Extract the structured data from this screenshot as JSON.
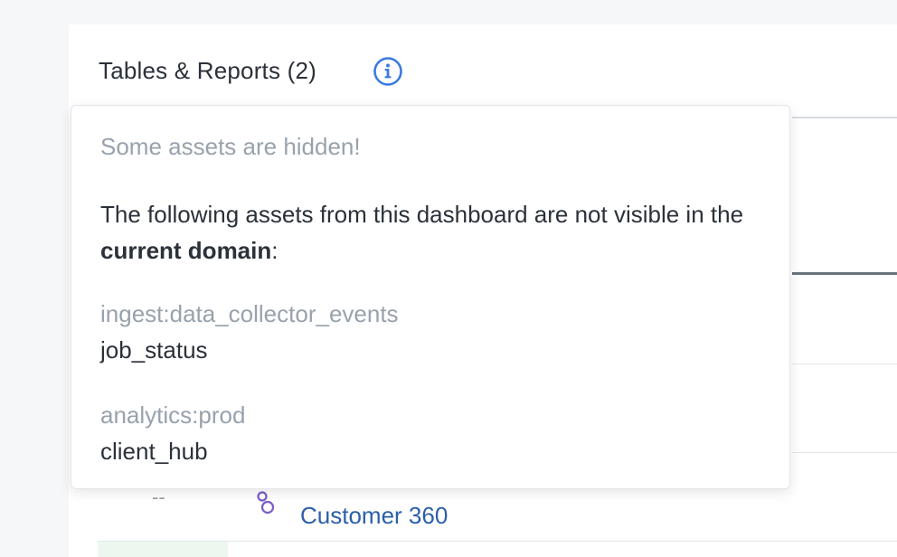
{
  "panel": {
    "title": "Tables & Reports (2)",
    "info_icon": "info-circle-icon"
  },
  "background": {
    "dash_placeholder": "--",
    "report_icon": "report-link-icon",
    "report_name": "Customer 360"
  },
  "popover": {
    "heading": "Some assets are hidden!",
    "body_prefix": "The following assets from this dashboard are not visible in the ",
    "body_bold": "current domain",
    "body_suffix": ":",
    "assets": [
      {
        "namespace": "ingest:data_collector_events",
        "name": "job_status"
      },
      {
        "namespace": "analytics:prod",
        "name": "client_hub"
      }
    ]
  },
  "colors": {
    "accent_blue": "#3b7be0",
    "link_blue": "#2b5fa8",
    "muted_text": "#98a2ad",
    "body_text": "#2b313a",
    "report_icon_purple": "#7a5cc7"
  }
}
